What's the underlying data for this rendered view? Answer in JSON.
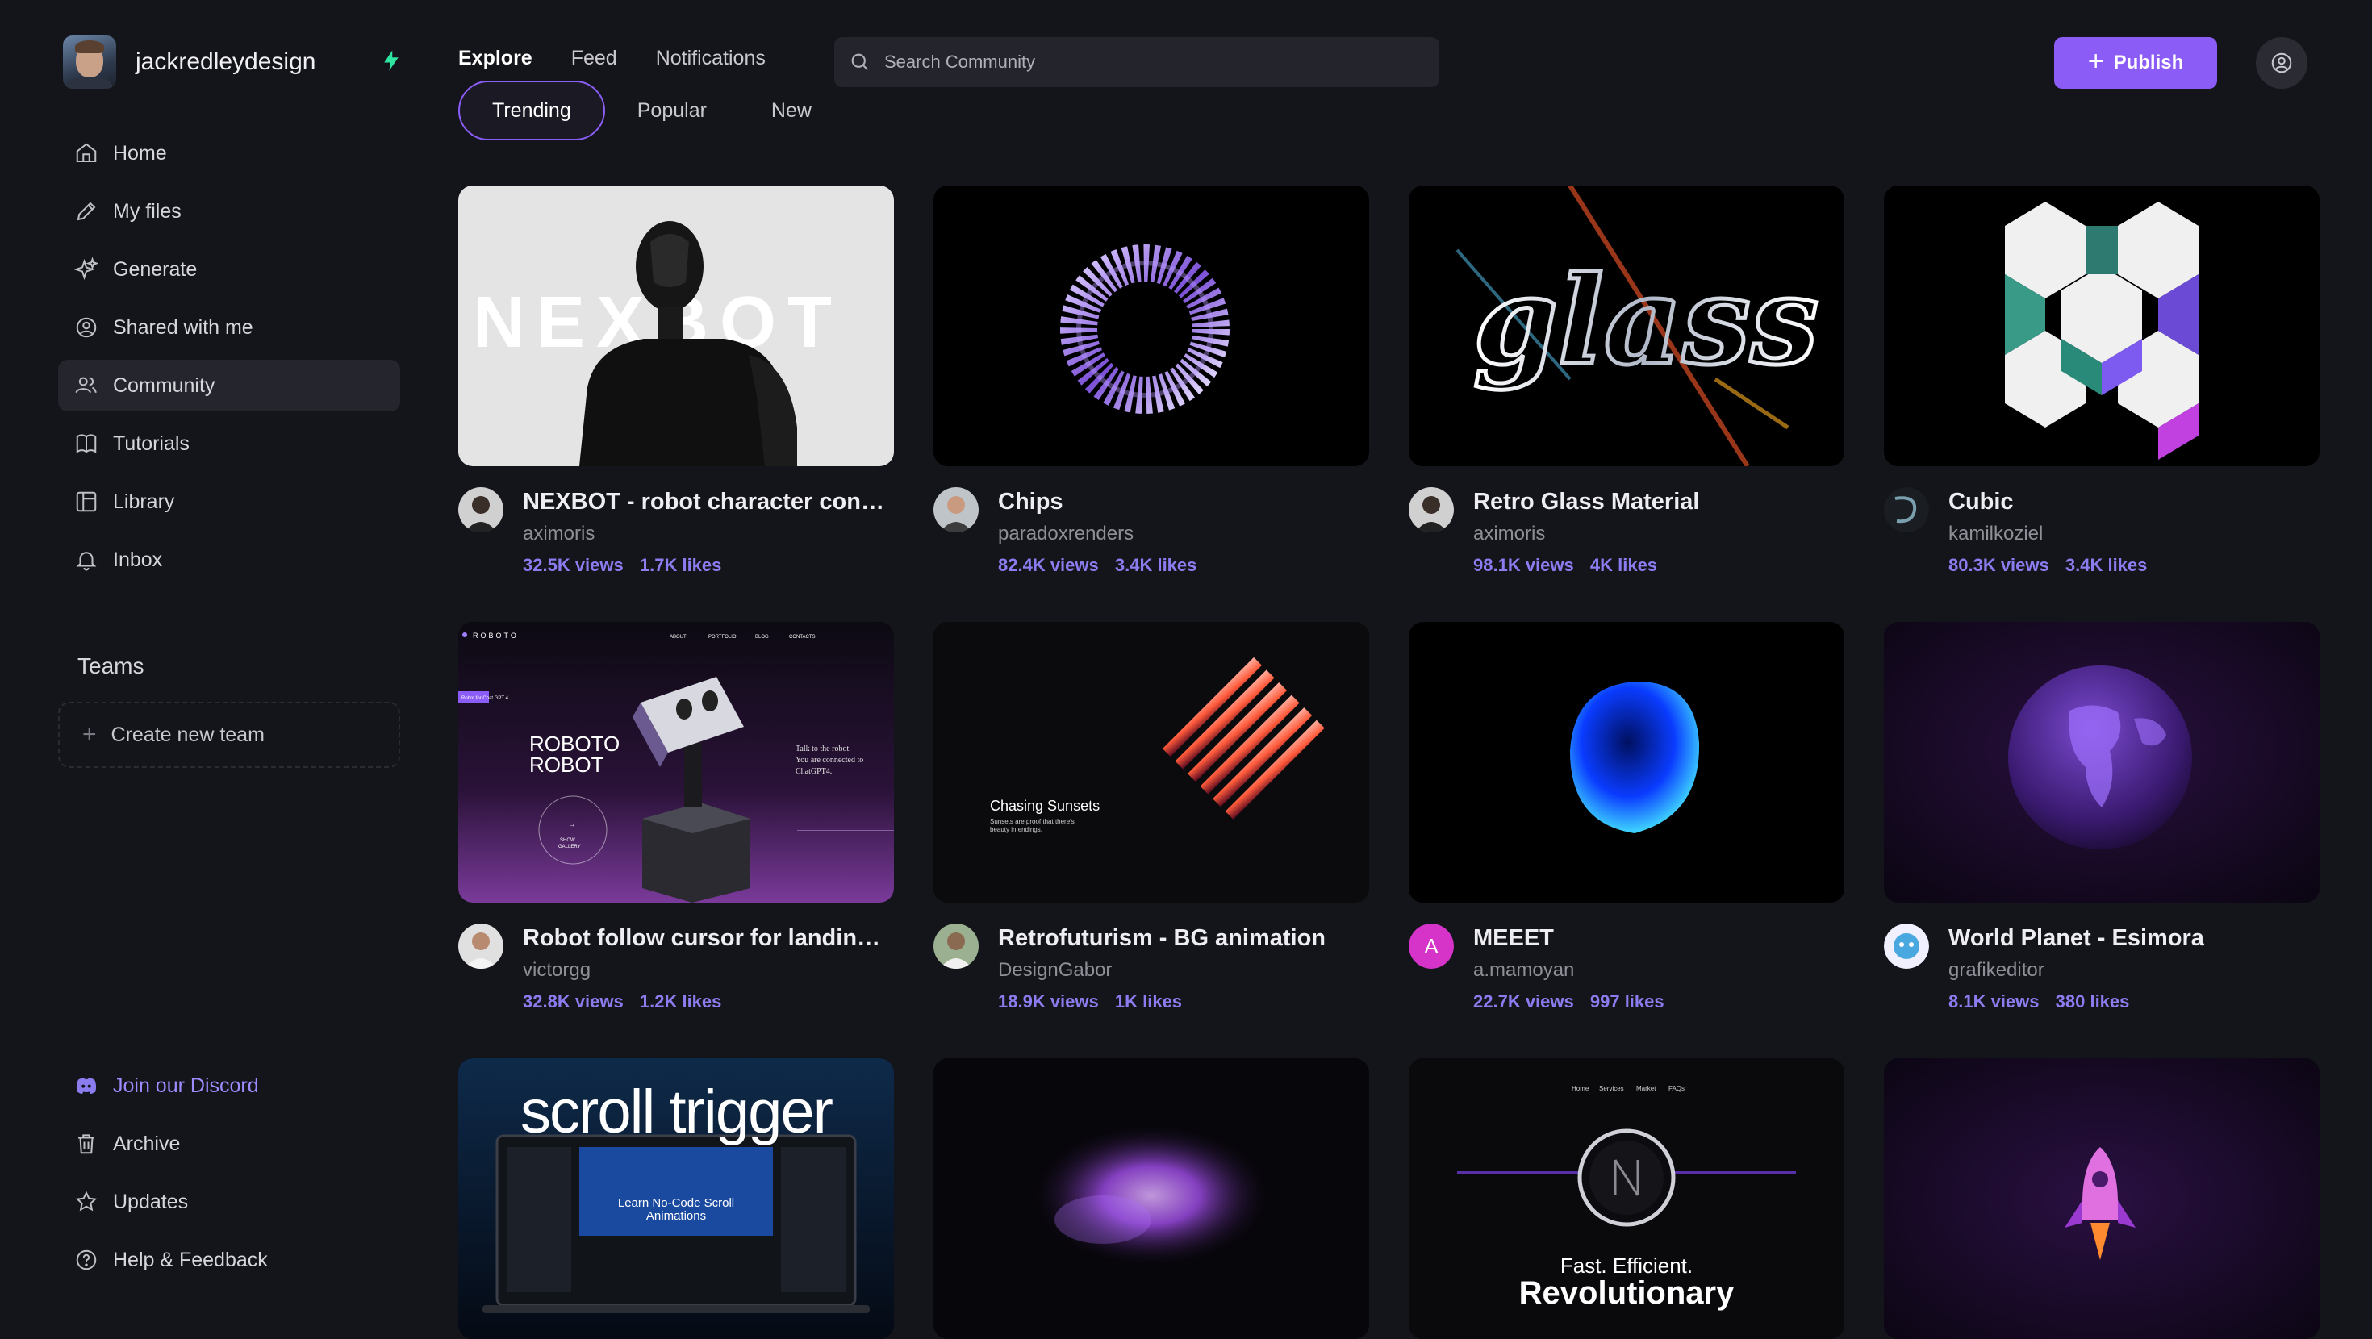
{
  "profile": {
    "username": "jackredleydesign"
  },
  "sidebar": {
    "items": [
      {
        "label": "Home",
        "icon": "home-icon"
      },
      {
        "label": "My files",
        "icon": "pencil-icon"
      },
      {
        "label": "Generate",
        "icon": "sparkle-icon"
      },
      {
        "label": "Shared with me",
        "icon": "user-circle-icon"
      },
      {
        "label": "Community",
        "icon": "users-icon",
        "active": true
      },
      {
        "label": "Tutorials",
        "icon": "book-icon"
      },
      {
        "label": "Library",
        "icon": "library-icon"
      },
      {
        "label": "Inbox",
        "icon": "bell-icon"
      }
    ],
    "teams_title": "Teams",
    "create_team": "Create new team",
    "bottom": [
      {
        "label": "Join our Discord",
        "icon": "discord-icon"
      },
      {
        "label": "Archive",
        "icon": "trash-icon"
      },
      {
        "label": "Updates",
        "icon": "star-icon"
      },
      {
        "label": "Help & Feedback",
        "icon": "help-icon"
      }
    ]
  },
  "header": {
    "tabs": [
      "Explore",
      "Feed",
      "Notifications"
    ],
    "active_tab": "Explore",
    "search_placeholder": "Search Community",
    "publish_label": "Publish"
  },
  "subtabs": [
    "Trending",
    "Popular",
    "New"
  ],
  "active_subtab": "Trending",
  "accent": "#8b5cf6",
  "cards": [
    {
      "title": "NEXBOT - robot character concept",
      "author": "aximoris",
      "views": "32.5K views",
      "likes": "1.7K likes"
    },
    {
      "title": "Chips",
      "author": "paradoxrenders",
      "views": "82.4K views",
      "likes": "3.4K likes"
    },
    {
      "title": "Retro Glass Material",
      "author": "aximoris",
      "views": "98.1K views",
      "likes": "4K likes"
    },
    {
      "title": "Cubic",
      "author": "kamilkoziel",
      "views": "80.3K views",
      "likes": "3.4K likes"
    },
    {
      "title": "Robot follow cursor for landing page",
      "author": "victorgg",
      "views": "32.8K views",
      "likes": "1.2K likes"
    },
    {
      "title": "Retrofuturism - BG animation",
      "author": "DesignGabor",
      "views": "18.9K views",
      "likes": "1K likes"
    },
    {
      "title": "MEEET",
      "author": "a.mamoyan",
      "views": "22.7K views",
      "likes": "997 likes",
      "avatar_letter": "A"
    },
    {
      "title": "World Planet - Esimora",
      "author": "grafikeditor",
      "views": "8.1K views",
      "likes": "380 likes"
    }
  ],
  "thumb_text": {
    "nexbot": "NEXBOT",
    "glass": "glass",
    "roboto_brand": "ROBOTO",
    "roboto_nav": [
      "ABOUT",
      "PORTFOLIO",
      "BLOG",
      "CONTACTS"
    ],
    "roboto_tag": "Robot for Chat GPT 4",
    "roboto_title_1": "ROBOTO",
    "roboto_title_2": "ROBOT",
    "roboto_side_1": "Talk to the robot.",
    "roboto_side_2": "You are connected to",
    "roboto_side_3": "ChatGPT4.",
    "roboto_circle_1": "SHOW",
    "roboto_circle_2": "GALLERY",
    "sunsets_title": "Chasing Sunsets",
    "sunsets_sub_1": "Sunsets are proof that there's",
    "sunsets_sub_2": "beauty in endings.",
    "scroll_trigger": "scroll trigger",
    "scroll_sub_1": "Learn No-Code Scroll",
    "scroll_sub_2": "Animations",
    "fast_nav": [
      "Home",
      "Services",
      "Market",
      "FAQs"
    ],
    "fast_1": "Fast. Efficient.",
    "fast_2": "Revolutionary"
  }
}
